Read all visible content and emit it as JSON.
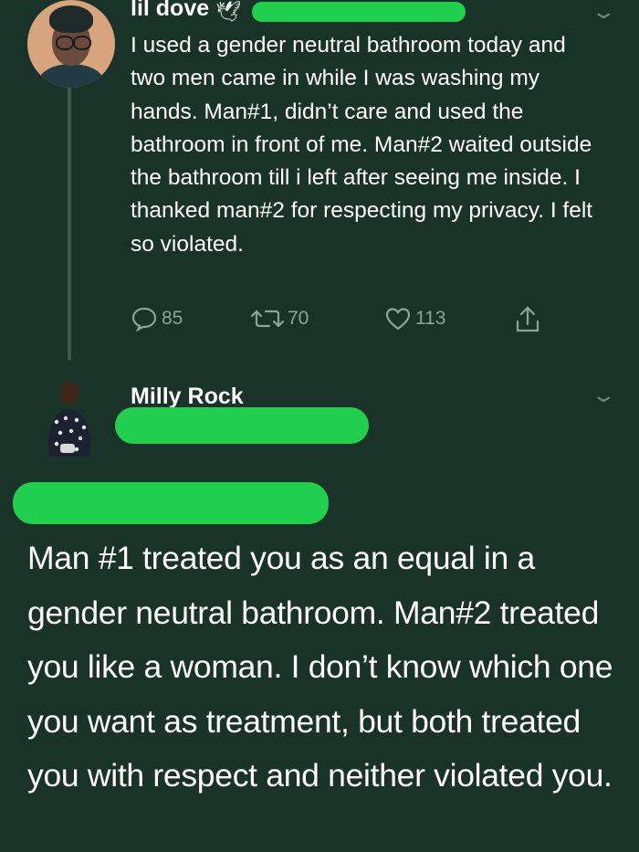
{
  "first_tweet": {
    "author_name": "lil dove",
    "text": "I used a gender neutral bathroom today and two men came in while I was washing my hands. Man#1, didn’t care and used the bathroom in front of me. Man#2 waited outside the bathroom till i left after seeing me inside. I thanked man#2 for respecting my privacy. I felt so violated.",
    "reply_count": "85",
    "retweet_count": "70",
    "like_count": "113",
    "icons": [
      "reply-icon",
      "retweet-icon",
      "like-icon",
      "share-icon",
      "chevron-down-icon"
    ]
  },
  "reply_tweet": {
    "author_name": "Milly Rock",
    "text": "Man #1 treated you as an equal in a gender neutral bathroom. Man#2 treated you like a woman. I don’t know which one you want as treatment, but both treated you with respect and neither violated you."
  },
  "colors": {
    "background": "#1a3328",
    "text": "#ffffff",
    "muted": "#8aa599",
    "redaction": "#22d04f"
  }
}
